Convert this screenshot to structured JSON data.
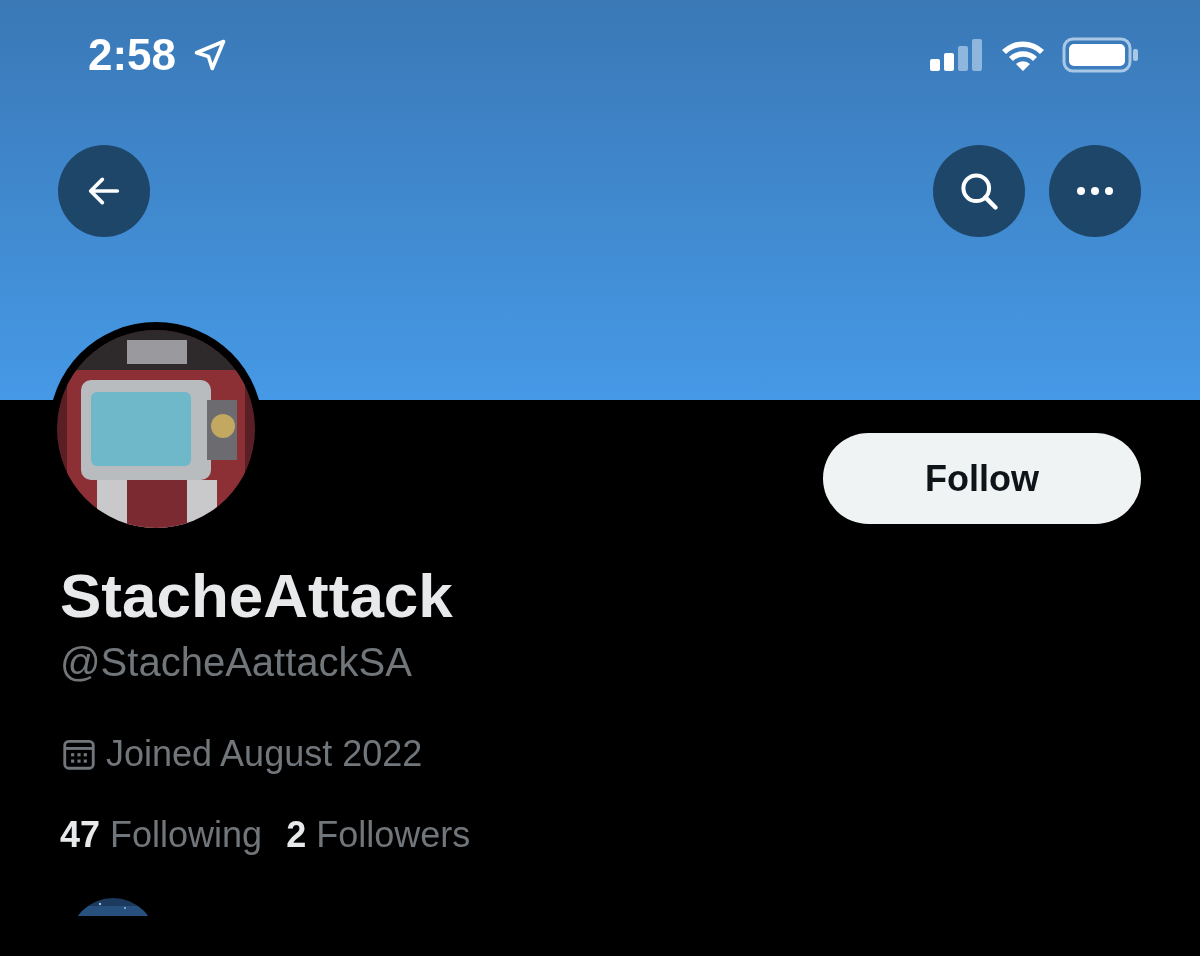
{
  "status_bar": {
    "time": "2:58"
  },
  "profile": {
    "name": "StacheAttack",
    "handle": "@StacheAattackSA",
    "joined": "Joined August 2022",
    "follow_button": "Follow",
    "stats": [
      {
        "count": "47",
        "label": "Following"
      },
      {
        "count": "2",
        "label": "Followers"
      }
    ]
  }
}
